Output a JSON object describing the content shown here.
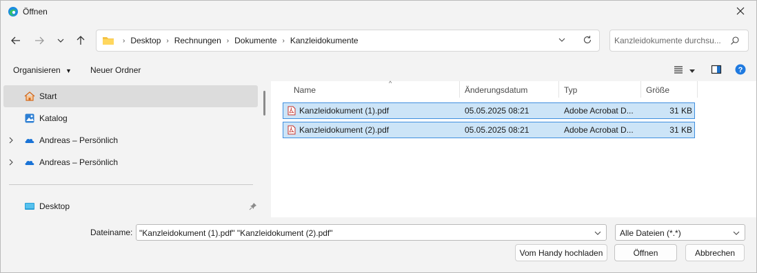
{
  "window": {
    "title": "Öffnen",
    "close_icon": "close-icon"
  },
  "address": {
    "crumbs": [
      "Desktop",
      "Rechnungen",
      "Dokumente",
      "Kanzleidokumente"
    ],
    "folder_icon": "folder-icon"
  },
  "search": {
    "placeholder": "Kanzleidokumente durchsu..."
  },
  "toolbar": {
    "organize_label": "Organisieren",
    "new_folder_label": "Neuer Ordner",
    "help_icon": "help-icon"
  },
  "sidebar": {
    "items": [
      {
        "label": "Start",
        "icon": "home-icon",
        "selected": true
      },
      {
        "label": "Katalog",
        "icon": "gallery-icon"
      },
      {
        "label": "Andreas – Persönlich",
        "icon": "onedrive-icon"
      },
      {
        "label": "Andreas – Persönlich",
        "icon": "onedrive-icon"
      },
      {
        "label": "Desktop",
        "icon": "desktop-icon"
      }
    ]
  },
  "files": {
    "columns": [
      "Name",
      "Änderungsdatum",
      "Typ",
      "Größe"
    ],
    "rows": [
      {
        "name": "Kanzleidokument (1).pdf",
        "date": "05.05.2025 08:21",
        "type": "Adobe Acrobat D...",
        "size": "31 KB"
      },
      {
        "name": "Kanzleidokument (2).pdf",
        "date": "05.05.2025 08:21",
        "type": "Adobe Acrobat D...",
        "size": "31 KB"
      }
    ]
  },
  "bottom": {
    "filename_label": "Dateiname:",
    "filename_value": "\"Kanzleidokument (1).pdf\" \"Kanzleidokument (2).pdf\"",
    "filetype_value": "Alle Dateien (*.*)",
    "upload_label": "Vom Handy hochladen",
    "open_label": "Öffnen",
    "cancel_label": "Abbrechen"
  }
}
